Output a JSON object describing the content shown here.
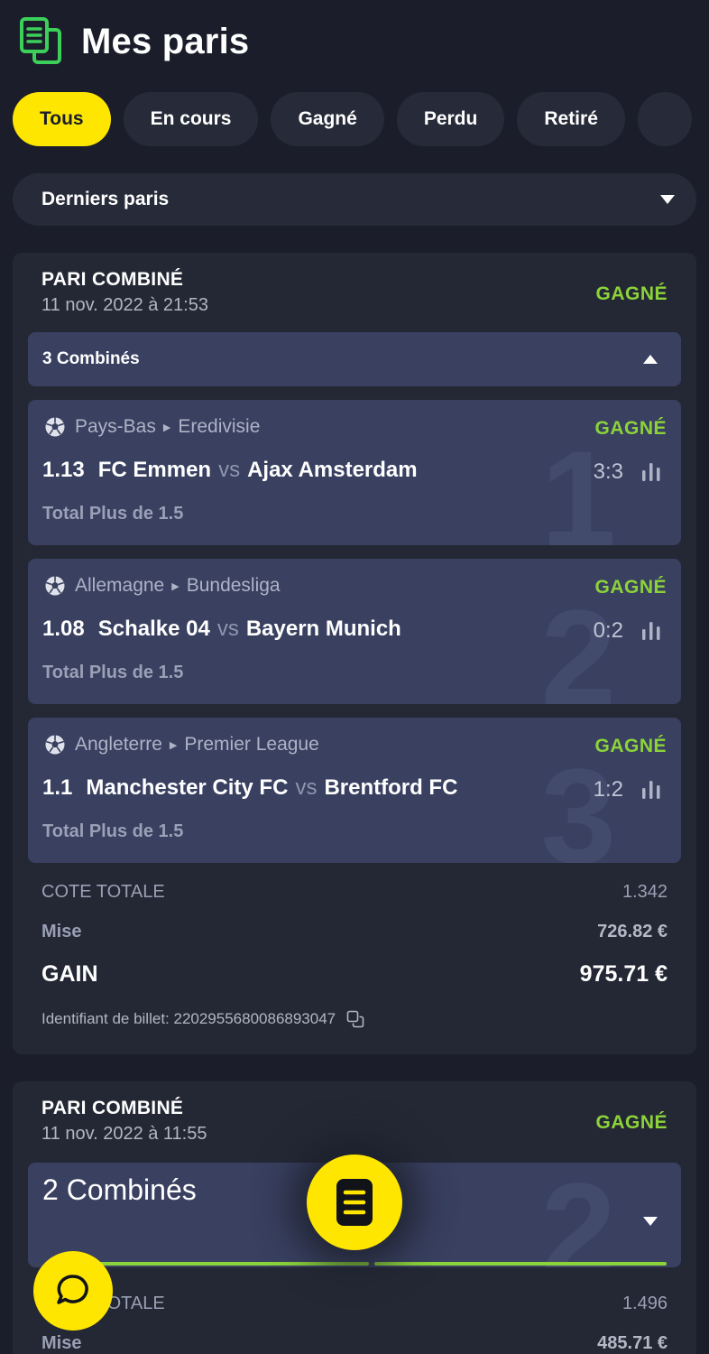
{
  "header": {
    "title": "Mes paris",
    "icon": "document-icon"
  },
  "filters": [
    {
      "label": "Tous",
      "active": true
    },
    {
      "label": "En cours",
      "active": false
    },
    {
      "label": "Gagné",
      "active": false
    },
    {
      "label": "Perdu",
      "active": false
    },
    {
      "label": "Retiré",
      "active": false
    }
  ],
  "sort": {
    "label": "Derniers paris"
  },
  "colors": {
    "accent": "#ffe600",
    "won": "#8cd33a",
    "background": "#1b1e2a",
    "card": "#242835",
    "leg": "#394060"
  },
  "bets": [
    {
      "type": "PARI COMBINÉ",
      "date": "11 nov. 2022 à 21:53",
      "status": "GAGNÉ",
      "combo_label": "3 Combinés",
      "legs": [
        {
          "number": "1",
          "country": "Pays-Bas",
          "league": "Eredivisie",
          "status": "GAGNÉ",
          "odd": "1.13",
          "home": "FC Emmen",
          "vs": "vs",
          "away": "Ajax Amsterdam",
          "score": "3:3",
          "selection": "Total Plus de 1.5"
        },
        {
          "number": "2",
          "country": "Allemagne",
          "league": "Bundesliga",
          "status": "GAGNÉ",
          "odd": "1.08",
          "home": "Schalke 04",
          "vs": "vs",
          "away": "Bayern Munich",
          "score": "0:2",
          "selection": "Total Plus de 1.5"
        },
        {
          "number": "3",
          "country": "Angleterre",
          "league": "Premier League",
          "status": "GAGNÉ",
          "odd": "1.1",
          "home": "Manchester City FC",
          "vs": "vs",
          "away": "Brentford FC",
          "score": "1:2",
          "selection": "Total Plus de 1.5"
        }
      ],
      "cote_label": "COTE TOTALE",
      "cote_value": "1.342",
      "mise_label": "Mise",
      "mise_value": "726.82 €",
      "gain_label": "GAIN",
      "gain_value": "975.71 €",
      "ticket_label": "Identifiant de billet: 2202955680086893047"
    },
    {
      "type": "PARI COMBINÉ",
      "date": "11 nov. 2022 à 11:55",
      "status": "GAGNÉ",
      "combo_label": "2 Combinés",
      "combo_number": "2",
      "cote_label": "COTE TOTALE",
      "cote_value": "1.496",
      "mise_label": "Mise",
      "mise_value": "485.71 €"
    }
  ]
}
